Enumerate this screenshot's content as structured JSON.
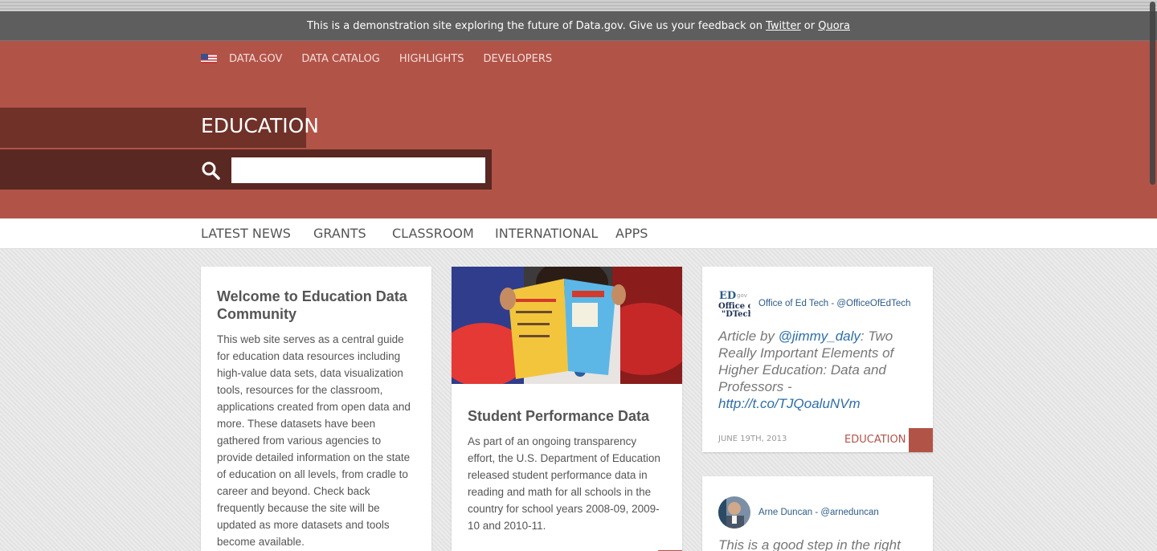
{
  "banner": {
    "text": "This is a demonstration site exploring the future of Data.gov. Give us your feedback on ",
    "twitter_link": "Twitter",
    "or": " or ",
    "quora_link": "Quora"
  },
  "topnav": {
    "items": [
      {
        "label": "DATA.GOV"
      },
      {
        "label": "DATA CATALOG"
      },
      {
        "label": "HIGHLIGHTS"
      },
      {
        "label": "DEVELOPERS"
      }
    ]
  },
  "page": {
    "title": "EDUCATION",
    "search_placeholder": ""
  },
  "subnav": {
    "items": [
      {
        "label": "LATEST NEWS"
      },
      {
        "label": "GRANTS"
      },
      {
        "label": "CLASSROOM"
      },
      {
        "label": "INTERNATIONAL"
      },
      {
        "label": "APPS"
      }
    ]
  },
  "welcome_card": {
    "title": "Welcome to Education Data Community",
    "body": "This web site serves as a central guide for education data resources including high-value data sets, data visualization tools, resources for the classroom, applications created from open data and more. These datasets have been gathered from various agencies to provide detailed information on the state of education on all levels, from cradle to career and beyond. Check back frequently because the site will be updated as more datasets and tools become available."
  },
  "performance_card": {
    "title": "Student Performance Data",
    "body": "As part of an ongoing transparency effort, the U.S. Department of Education released student performance data in reading and math for all schools in the country for school years 2008-09, 2009-10 and 2010-11."
  },
  "tweet1": {
    "handle": "Office of Ed Tech - @OfficeOfEdTech",
    "text_prefix": "Article by ",
    "mention": "@jimmy_daly",
    "text_body": ": Two Really Important Elements of Higher Education: Data and Professors - ",
    "link": "http://t.co/TJQoaluNVm",
    "date": "June 19th, 2013",
    "category": "EDUCATION"
  },
  "tweet2": {
    "handle": "Arne Duncan - @arneduncan",
    "text": "This is a good step in the right"
  },
  "colors": {
    "brand": "#b25348",
    "brand_dark": "#6f3128",
    "link": "#2d6ea8"
  }
}
